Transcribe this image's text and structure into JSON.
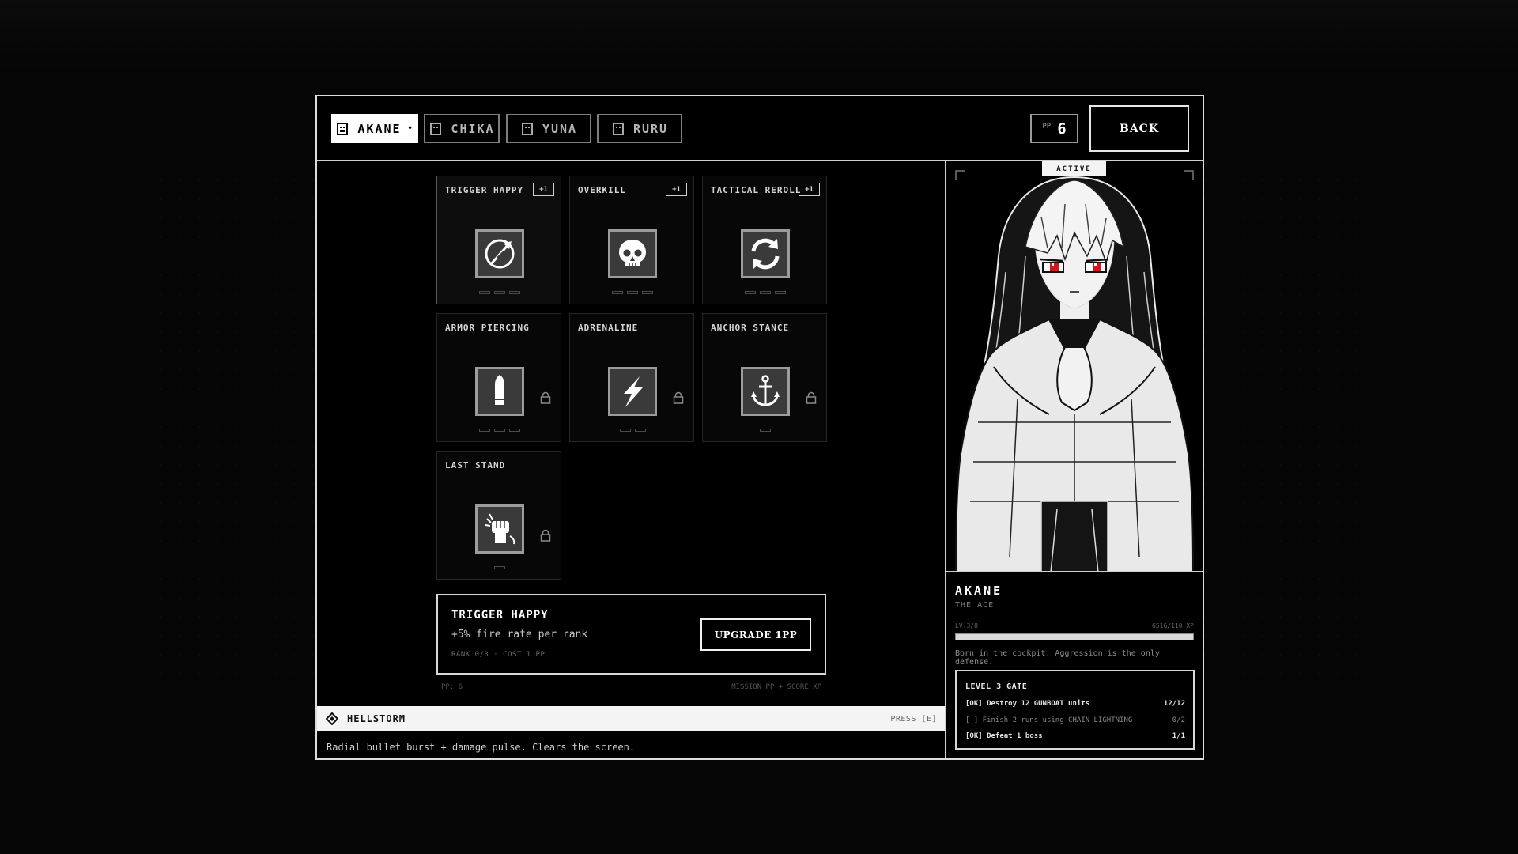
{
  "tabs": [
    {
      "label": "AKANE",
      "marker": "•",
      "active": true
    },
    {
      "label": "CHIKA",
      "marker": "",
      "active": false
    },
    {
      "label": "YUNA",
      "marker": "",
      "active": false
    },
    {
      "label": "RURU",
      "marker": "",
      "active": false
    }
  ],
  "header": {
    "pp_label": "PP",
    "pp_value": "6",
    "back_label": "BACK"
  },
  "skills": [
    {
      "name": "TRIGGER HAPPY",
      "badge": "+1",
      "icon": "arrow-circle-icon",
      "locked": false,
      "ranks": 3,
      "selected": true
    },
    {
      "name": "OVERKILL",
      "badge": "+1",
      "icon": "skull-icon",
      "locked": false,
      "ranks": 3,
      "selected": false
    },
    {
      "name": "TACTICAL REROLL",
      "badge": "+1",
      "icon": "reroll-arrows-icon",
      "locked": false,
      "ranks": 3,
      "selected": false
    },
    {
      "name": "ARMOR PIERCING",
      "badge": "",
      "icon": "bullet-icon",
      "locked": true,
      "ranks": 3,
      "selected": false
    },
    {
      "name": "ADRENALINE",
      "badge": "",
      "icon": "lightning-icon",
      "locked": true,
      "ranks": 2,
      "selected": false
    },
    {
      "name": "ANCHOR STANCE",
      "badge": "",
      "icon": "anchor-icon",
      "locked": true,
      "ranks": 1,
      "selected": false
    },
    {
      "name": "LAST STAND",
      "badge": "",
      "icon": "fist-icon",
      "locked": true,
      "ranks": 1,
      "selected": false
    }
  ],
  "detail": {
    "title": "TRIGGER HAPPY",
    "description": "+5% fire rate per rank",
    "meta": "RANK 0/3 · COST 1 PP",
    "button": "UPGRADE 1PP"
  },
  "footer": {
    "pp": "PP: 6",
    "source": "MISSION PP + SCORE XP"
  },
  "ultimate": {
    "name": "HELLSTORM",
    "key_hint": "PRESS [E]",
    "description": "Radial bullet burst + damage pulse. Clears the screen."
  },
  "character": {
    "active_tag": "ACTIVE",
    "name": "AKANE",
    "title": "THE ACE",
    "level": "LV.3/8",
    "xp_text": "6516/110 XP",
    "xp_fraction": 1.0,
    "bio": "Born in the cockpit. Aggression is the only defense."
  },
  "gate": {
    "title": "LEVEL 3 GATE",
    "rows": [
      {
        "text": "[OK] Destroy 12 GUNBOAT units",
        "progress": "12/12",
        "done": true
      },
      {
        "text": "[ ] Finish 2 runs using CHAIN LIGHTNING",
        "progress": "0/2",
        "done": false
      },
      {
        "text": "[OK] Defeat 1 boss",
        "progress": "1/1",
        "done": true
      }
    ]
  }
}
